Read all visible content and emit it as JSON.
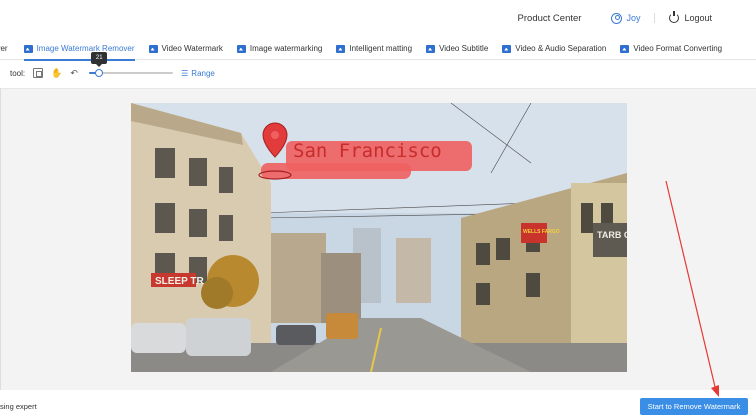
{
  "header": {
    "product_center": "Product Center",
    "user_name": "Joy",
    "logout": "Logout"
  },
  "tabs": [
    {
      "label": "over",
      "icon": "none"
    },
    {
      "label": "Image Watermark Remover",
      "icon": "image-icon",
      "active": true
    },
    {
      "label": "Video Watermark",
      "icon": "video-icon"
    },
    {
      "label": "Image watermarking",
      "icon": "image-icon"
    },
    {
      "label": "Intelligent matting",
      "icon": "wand-icon"
    },
    {
      "label": "Video Subtitle",
      "icon": "video-icon"
    },
    {
      "label": "Video & Audio Separation",
      "icon": "video-icon"
    },
    {
      "label": "Video Format Converting",
      "icon": "file-icon"
    }
  ],
  "toolbar": {
    "label": "tool:",
    "brush_size": "21",
    "brush_fraction": 0.12,
    "range_label": "Range"
  },
  "photo": {
    "sign_text": "San Francisco",
    "bank_sign": "WELLS FARGO",
    "shop_sign": "SLEEP TR",
    "cafe_sign": "TARB COF"
  },
  "footer": {
    "left_text": "sing expert",
    "start_button": "Start to Remove Watermark"
  },
  "colors": {
    "accent": "#3a7bd5",
    "button": "#3a8ee6",
    "highlight": "#ff4b4b",
    "arrow": "#e53935"
  }
}
